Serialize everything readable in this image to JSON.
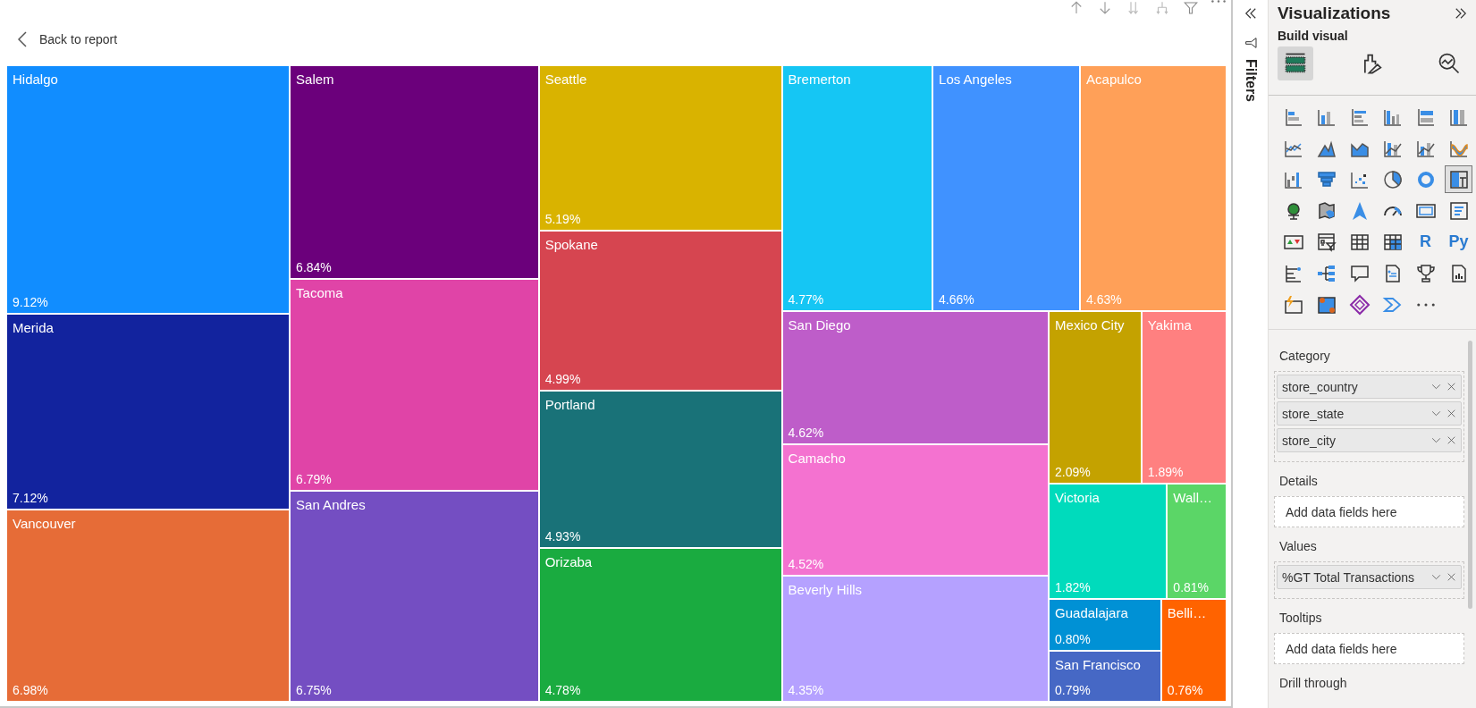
{
  "back_link": {
    "label": "Back to report"
  },
  "treemap": {
    "kind": "row",
    "children": [
      {
        "kind": "column",
        "children": [
          {
            "kind": "tile",
            "name": "Hidalgo",
            "value": "9.12%",
            "color": "#118dff"
          },
          {
            "kind": "tile",
            "name": "Merida",
            "value": "7.12%",
            "color": "#12239e"
          },
          {
            "kind": "tile",
            "name": "Vancouver",
            "value": "6.98%",
            "color": "#e66c37"
          }
        ]
      },
      {
        "kind": "column",
        "children": [
          {
            "kind": "tile",
            "name": "Salem",
            "value": "6.84%",
            "color": "#6b007b"
          },
          {
            "kind": "tile",
            "name": "Tacoma",
            "value": "6.79%",
            "color": "#e044a7"
          },
          {
            "kind": "tile",
            "name": "San Andres",
            "value": "6.75%",
            "color": "#744ec2"
          }
        ]
      },
      {
        "kind": "column",
        "children": [
          {
            "kind": "tile",
            "name": "Seattle",
            "value": "5.19%",
            "color": "#d9b300"
          },
          {
            "kind": "tile",
            "name": "Spokane",
            "value": "4.99%",
            "color": "#d64550"
          },
          {
            "kind": "tile",
            "name": "Portland",
            "value": "4.93%",
            "color": "#197278"
          },
          {
            "kind": "tile",
            "name": "Orizaba",
            "value": "4.78%",
            "color": "#1aab40"
          }
        ]
      },
      {
        "kind": "column",
        "children": [
          {
            "kind": "row",
            "children": [
              {
                "kind": "tile",
                "name": "Bremerton",
                "value": "4.77%",
                "color": "#15c6f4"
              },
              {
                "kind": "tile",
                "name": "Los Angeles",
                "value": "4.66%",
                "color": "#4092ff"
              },
              {
                "kind": "tile",
                "name": "Acapulco",
                "value": "4.63%",
                "color": "#ffa058"
              }
            ]
          },
          {
            "kind": "row",
            "children": [
              {
                "kind": "column",
                "children": [
                  {
                    "kind": "tile",
                    "name": "San Diego",
                    "value": "4.62%",
                    "color": "#be5dc9"
                  },
                  {
                    "kind": "tile",
                    "name": "Camacho",
                    "value": "4.52%",
                    "color": "#f472d0"
                  },
                  {
                    "kind": "tile",
                    "name": "Beverly Hills",
                    "value": "4.35%",
                    "color": "#b5a1ff"
                  }
                ]
              },
              {
                "kind": "column",
                "children": [
                  {
                    "kind": "row",
                    "children": [
                      {
                        "kind": "tile",
                        "name": "Mexico City",
                        "value": "2.09%",
                        "color": "#c4a200"
                      },
                      {
                        "kind": "tile",
                        "name": "Yakima",
                        "value": "1.89%",
                        "color": "#ff8080"
                      }
                    ]
                  },
                  {
                    "kind": "row",
                    "children": [
                      {
                        "kind": "tile",
                        "name": "Victoria",
                        "value": "1.82%",
                        "color": "#00dbbc"
                      },
                      {
                        "kind": "tile",
                        "name": "Wall…",
                        "value": "0.81%",
                        "color": "#5bd667"
                      }
                    ]
                  },
                  {
                    "kind": "row",
                    "children": [
                      {
                        "kind": "column",
                        "children": [
                          {
                            "kind": "tile",
                            "name": "Guadalajara",
                            "value": "0.80%",
                            "color": "#0091d5"
                          },
                          {
                            "kind": "tile",
                            "name": "San Francisco",
                            "value": "0.79%",
                            "color": "#4668c5"
                          }
                        ]
                      },
                      {
                        "kind": "tile",
                        "name": "Belli…",
                        "value": "0.76%",
                        "color": "#ff6300"
                      }
                    ]
                  }
                ]
              }
            ]
          }
        ]
      }
    ]
  },
  "filters_pane": {
    "label": "Filters"
  },
  "visualizations": {
    "title": "Visualizations",
    "subtitle": "Build visual",
    "build_tabs": [
      {
        "selected": true
      },
      {
        "selected": false
      },
      {
        "selected": false
      }
    ],
    "visual_types": [
      {
        "selected": false
      },
      {
        "selected": false
      },
      {
        "selected": false
      },
      {
        "selected": false
      },
      {
        "selected": false
      },
      {
        "selected": false
      },
      {
        "selected": false
      },
      {
        "selected": false
      },
      {
        "selected": false
      },
      {
        "selected": false
      },
      {
        "selected": false
      },
      {
        "selected": false
      },
      {
        "selected": false
      },
      {
        "selected": false
      },
      {
        "selected": false
      },
      {
        "selected": false
      },
      {
        "selected": false
      },
      {
        "selected": true
      },
      {
        "selected": false
      },
      {
        "selected": false
      },
      {
        "selected": false
      },
      {
        "selected": false
      },
      {
        "selected": false
      },
      {
        "selected": false
      },
      {
        "selected": false
      },
      {
        "selected": false
      },
      {
        "selected": false
      },
      {
        "selected": false
      },
      {
        "glyph": "R",
        "selected": false
      },
      {
        "glyph": "Py",
        "selected": false
      },
      {
        "selected": false
      },
      {
        "selected": false
      },
      {
        "selected": false
      },
      {
        "selected": false
      },
      {
        "selected": false
      },
      {
        "selected": false
      },
      {
        "selected": false
      },
      {
        "selected": false
      },
      {
        "selected": false
      },
      {
        "selected": false
      }
    ],
    "wells": [
      {
        "title": "Category",
        "fields": [
          "store_country",
          "store_state",
          "store_city"
        ]
      },
      {
        "title": "Details",
        "placeholder": "Add data fields here"
      },
      {
        "title": "Values",
        "fields": [
          "%GT Total Transactions"
        ]
      },
      {
        "title": "Tooltips",
        "placeholder": "Add data fields here"
      },
      {
        "title": "Drill through"
      }
    ]
  }
}
